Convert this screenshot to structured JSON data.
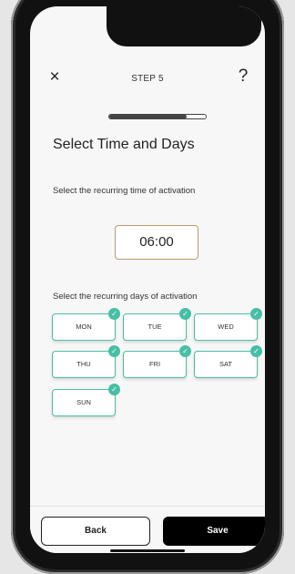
{
  "header": {
    "step_label": "STEP 5",
    "close_icon": "×",
    "help_icon": "?",
    "progress_fraction": 0.8
  },
  "main": {
    "title": "Select Time and Days",
    "time_label": "Select the recurring time of activation",
    "time_value": "06:00",
    "days_label": "Select the recurring days of activation",
    "days": [
      {
        "label": "MON",
        "selected": true
      },
      {
        "label": "TUE",
        "selected": true
      },
      {
        "label": "WED",
        "selected": true
      },
      {
        "label": "THU",
        "selected": true
      },
      {
        "label": "FRI",
        "selected": true
      },
      {
        "label": "SAT",
        "selected": true
      },
      {
        "label": "SUN",
        "selected": true
      }
    ],
    "check_icon": "✓"
  },
  "footer": {
    "back_label": "Back",
    "save_label": "Save"
  },
  "colors": {
    "accent": "#48bfa4",
    "time_border": "#b99a72",
    "primary_button": "#000000"
  }
}
